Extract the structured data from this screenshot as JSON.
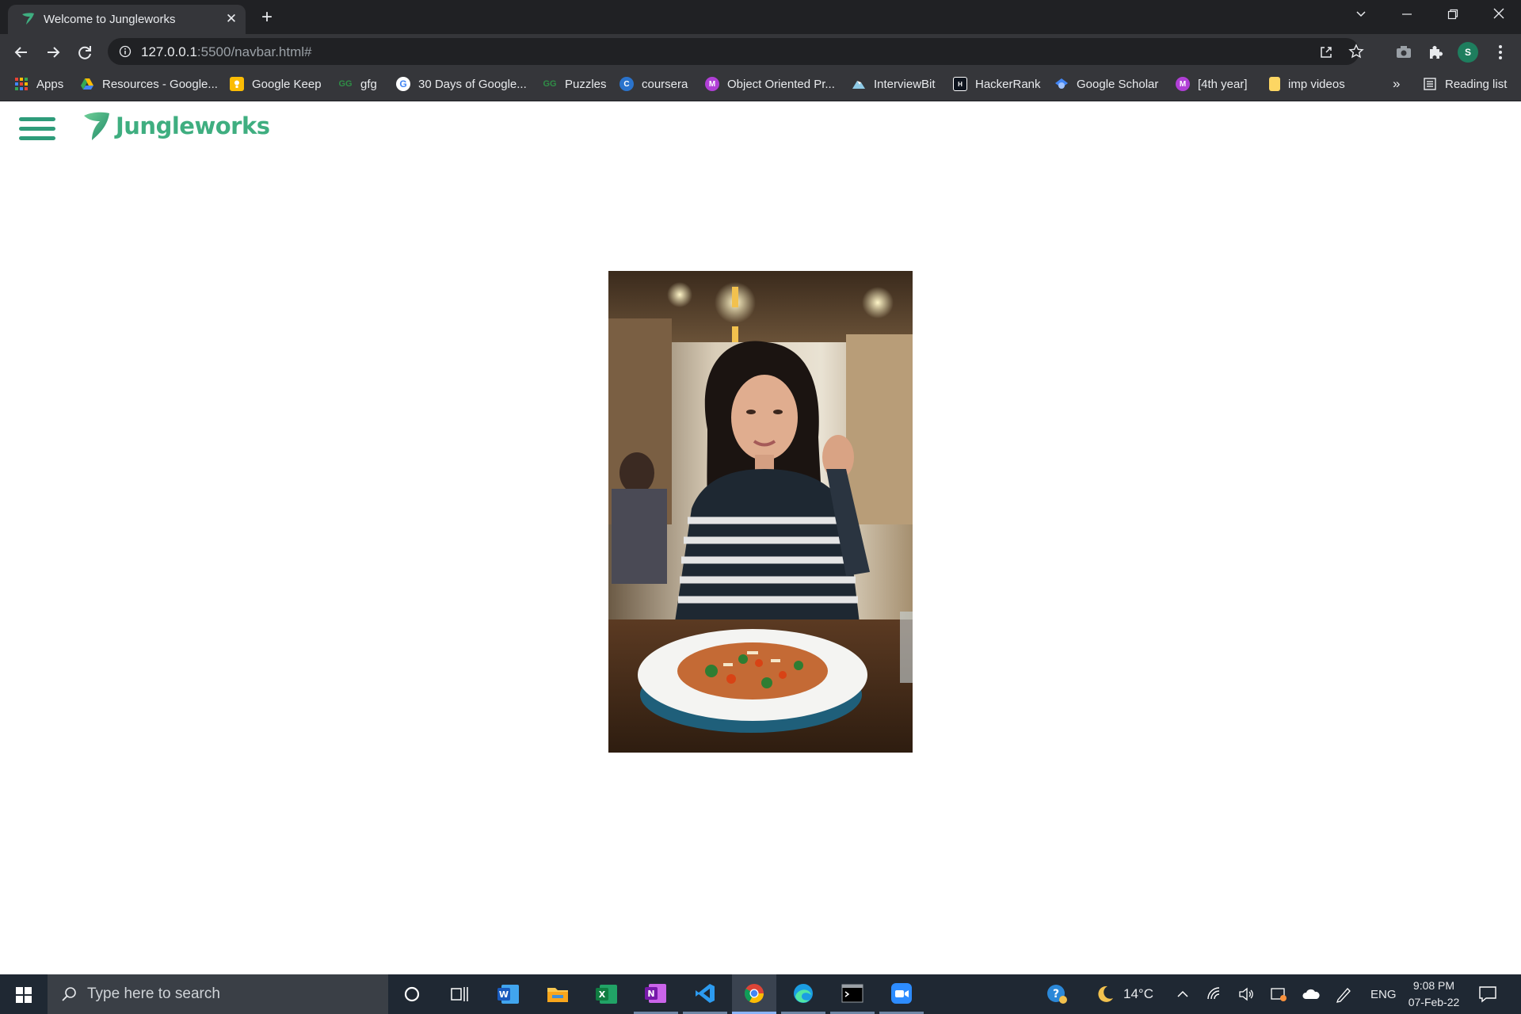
{
  "browser": {
    "tab_title": "Welcome to Jungleworks",
    "url_host": "127.0.0.1",
    "url_path": ":5500/navbar.html#",
    "profile_initial": "S"
  },
  "bookmarks": [
    {
      "label": "Apps",
      "icon": "apps-grid-icon",
      "color": "#ea4335"
    },
    {
      "label": "Resources - Google...",
      "icon": "google-drive-icon",
      "color": "#fbbc04"
    },
    {
      "label": "Google Keep",
      "icon": "google-keep-icon",
      "color": "#fbbc04"
    },
    {
      "label": "gfg",
      "icon": "gfg-icon",
      "color": "#2f8d46"
    },
    {
      "label": "30 Days of Google...",
      "icon": "google-icon",
      "color": "#ffffff"
    },
    {
      "label": "Puzzles",
      "icon": "gfg-icon",
      "color": "#2f8d46"
    },
    {
      "label": "coursera",
      "icon": "coursera-icon",
      "color": "#2a73cc"
    },
    {
      "label": "Object Oriented Pr...",
      "icon": "medium-m-icon",
      "color": "#b03fd6"
    },
    {
      "label": "InterviewBit",
      "icon": "interviewbit-icon",
      "color": "#8ecae6"
    },
    {
      "label": "HackerRank",
      "icon": "hackerrank-icon",
      "color": "#0e141e"
    },
    {
      "label": "Google Scholar",
      "icon": "google-scholar-icon",
      "color": "#4285f4"
    },
    {
      "label": "[4th year]",
      "icon": "medium-m-icon",
      "color": "#b03fd6"
    },
    {
      "label": "imp videos",
      "icon": "folder-icon",
      "color": "#fdd663"
    }
  ],
  "bookmarks_overflow": "»",
  "reading_list": "Reading list",
  "page": {
    "brand_name": "Jungleworks",
    "brand_color": "#3fae80",
    "hamburger_color": "#2e9c7a",
    "photo_alt": "Photo"
  },
  "taskbar": {
    "search_placeholder": "Type here to search",
    "weather": "14°C",
    "language": "ENG",
    "time": "9:08 PM",
    "date": "07-Feb-22"
  }
}
